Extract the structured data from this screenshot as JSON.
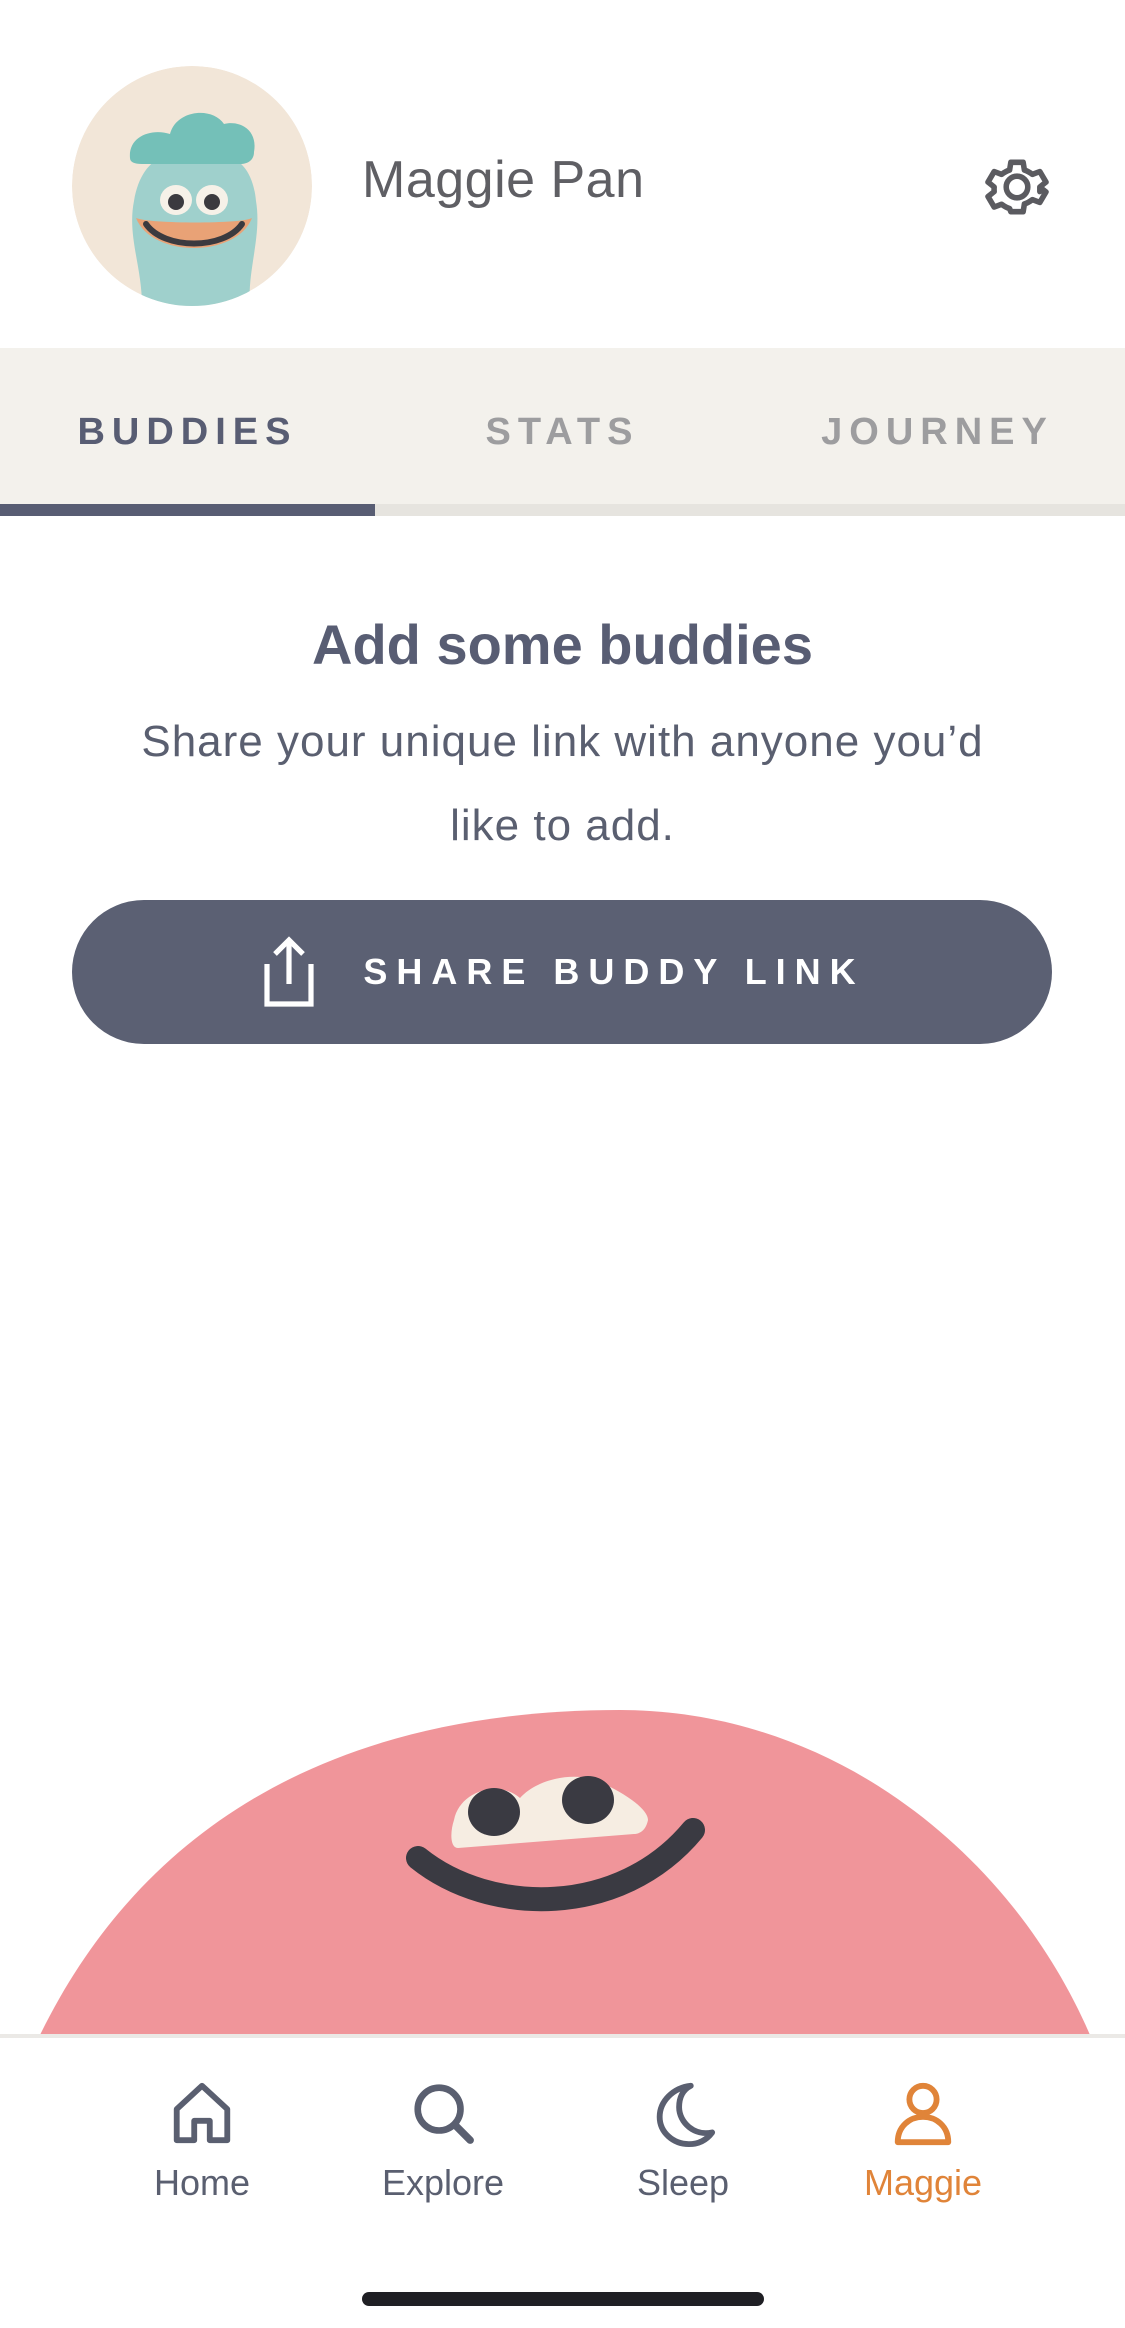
{
  "profile": {
    "name": "Maggie Pan",
    "avatar_icon": "blue-monster-avatar",
    "settings_icon": "gear-icon"
  },
  "tabs": [
    {
      "label": "BUDDIES",
      "active": true
    },
    {
      "label": "STATS",
      "active": false
    },
    {
      "label": "JOURNEY",
      "active": false
    }
  ],
  "empty_state": {
    "title": "Add some buddies",
    "text": "Share your unique link with anyone you’d like to add.",
    "button_label": "SHARE BUDDY LINK",
    "button_icon": "share-icon"
  },
  "nav": {
    "items": [
      {
        "label": "Home",
        "icon": "home-icon",
        "active": false
      },
      {
        "label": "Explore",
        "icon": "search-icon",
        "active": false
      },
      {
        "label": "Sleep",
        "icon": "moon-icon",
        "active": false
      },
      {
        "label": "Maggie",
        "icon": "person-icon",
        "active": true
      }
    ]
  },
  "colors": {
    "primary": "#585d73",
    "accent": "#e08439",
    "tab_bg": "#f3f1ec",
    "illustration": "#f0959a"
  }
}
